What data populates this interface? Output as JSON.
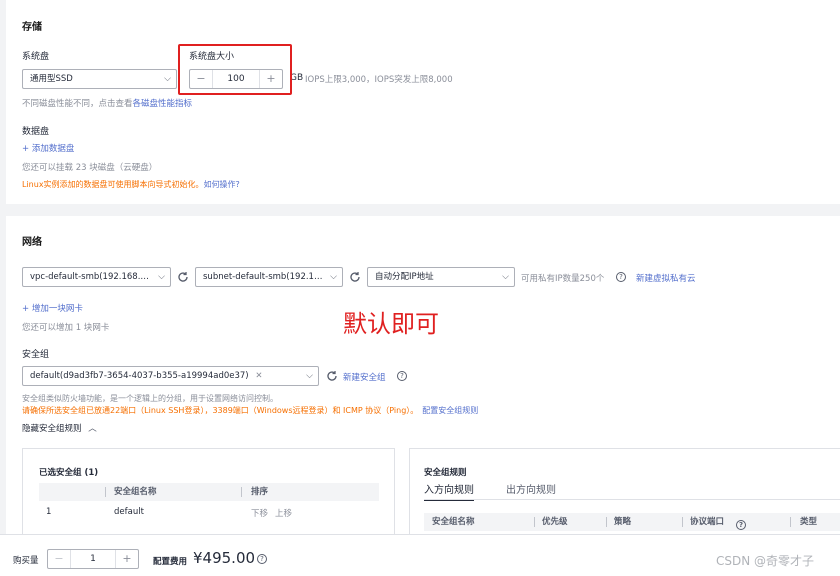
{
  "storage": {
    "title": "存储",
    "system_disk_label": "系统盘",
    "system_disk_type": "通用型SSD",
    "system_disk_size_label": "系统盘大小",
    "size_value": "100",
    "size_unit": "GB",
    "iops_text": "IOPS上限3,000，IOPS突发上限8,000",
    "perf_hint": "不同磁盘性能不同，点击查看",
    "perf_link": "各磁盘性能指标",
    "data_disk_label": "数据盘",
    "add_data_disk": "+ 添加数据盘",
    "mount_hint": "您还可以挂载 23 块磁盘（云硬盘）",
    "linux_warn": "Linux实例添加的数据盘可使用脚本向导式初始化。",
    "linux_link": "如何操作?"
  },
  "network": {
    "title": "网络",
    "vpc": "vpc-default-smb(192.168.…",
    "subnet": "subnet-default-smb(192.1…",
    "ip_mode": "自动分配IP地址",
    "ip_avail": "可用私有IP数量250个",
    "new_vpc_link": "新建虚拟私有云",
    "add_nic": "+ 增加一块网卡",
    "nic_hint": "您还可以增加 1 块网卡",
    "annotation": "默认即可",
    "sg_label": "安全组",
    "sg_value": "default(d9ad3fb7-3654-4037-b355-a19994ad0e37)",
    "new_sg_link": "新建安全组",
    "sg_desc": "安全组类似防火墙功能，是一个逻辑上的分组，用于设置网络访问控制。",
    "sg_warn": "请确保所选安全组已放通22端口（Linux SSH登录），3389端口（Windows远程登录）和 ICMP 协议（Ping）。",
    "sg_config_link": "配置安全组规则",
    "hide_rules": "隐藏安全组规则"
  },
  "selected_sg": {
    "title": "已选安全组 (1)",
    "headers": [
      "安全组名称",
      "排序"
    ],
    "rows": [
      {
        "name": "default",
        "down": "下移",
        "up": "上移",
        "index": "1"
      }
    ]
  },
  "sg_rules": {
    "title": "安全组规则",
    "tabs": [
      "入方向规则",
      "出方向规则"
    ],
    "headers": [
      "安全组名称",
      "优先级",
      "策略",
      "协议端口",
      "类型"
    ]
  },
  "footer": {
    "qty_label": "购买量",
    "qty_value": "1",
    "fee_label": "配置费用",
    "fee_value": "¥495.00",
    "watermark": "CSDN @奇零才子"
  },
  "colors": {
    "accent": "#526ecc",
    "warn": "#f66f00",
    "highlight_box": "#e02020",
    "annotation": "#e02020"
  }
}
